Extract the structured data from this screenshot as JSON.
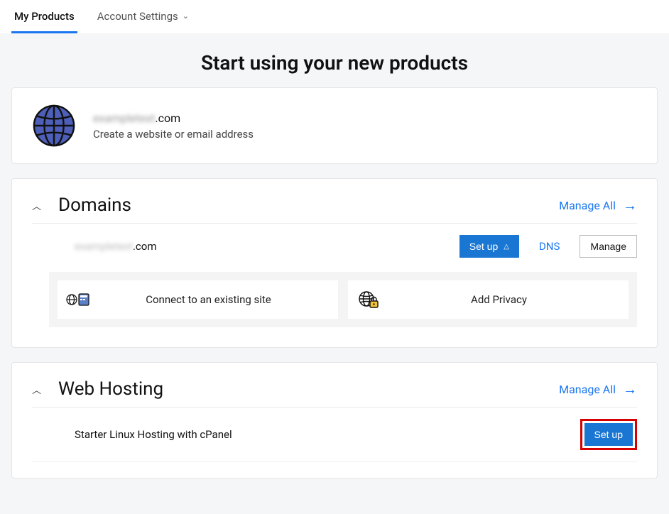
{
  "tabs": {
    "my_products": "My Products",
    "account_settings": "Account Settings"
  },
  "hero": {
    "title": "Start using your new products"
  },
  "banner": {
    "domain_suffix": ".com",
    "subtitle": "Create a website or email address"
  },
  "domains": {
    "title": "Domains",
    "manage_all": "Manage All",
    "item_suffix": ".com",
    "setup_btn": "Set up",
    "dns_link": "DNS",
    "manage_btn": "Manage",
    "tile_connect": "Connect to an existing site",
    "tile_privacy": "Add Privacy"
  },
  "hosting": {
    "title": "Web Hosting",
    "manage_all": "Manage All",
    "item_name": "Starter Linux Hosting with cPanel",
    "setup_btn": "Set up"
  }
}
